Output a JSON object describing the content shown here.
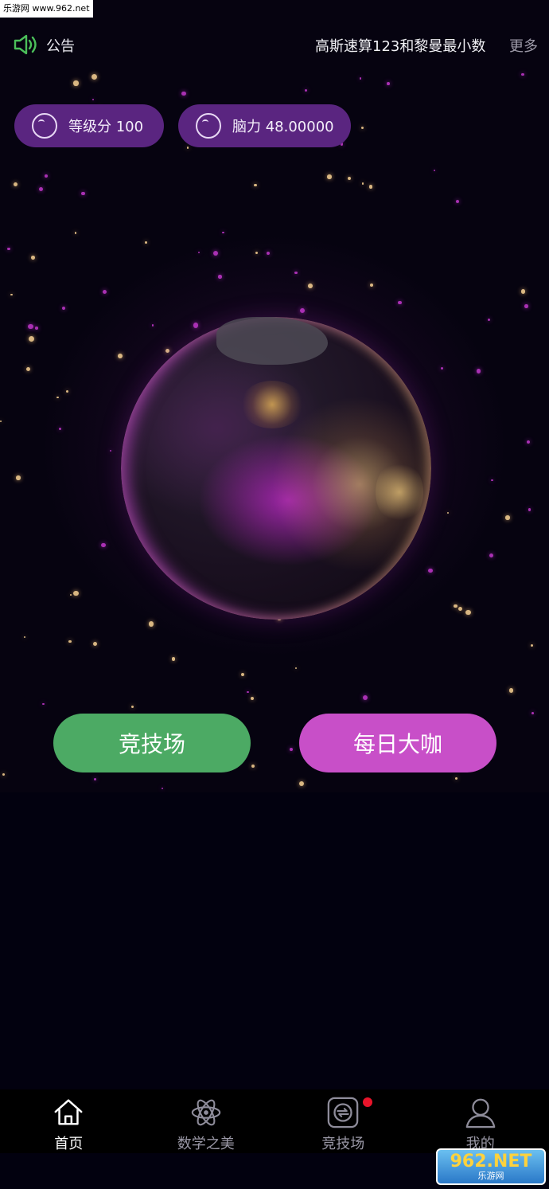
{
  "watermark": {
    "top_text": "乐游网 www.962.net",
    "brand": "962.NET",
    "brand_sub": "乐游网"
  },
  "notice": {
    "label": "公告",
    "marquee": "高斯速算123和黎曼最小数",
    "more": "更多"
  },
  "stats": {
    "level": "等级分 100",
    "brain": "脑力 48.00000"
  },
  "actions": {
    "arena": "竞技场",
    "daily": "每日大咖"
  },
  "tabs": [
    {
      "label": "首页",
      "icon": "home-icon",
      "active": true
    },
    {
      "label": "数学之美",
      "icon": "atom-icon",
      "active": false
    },
    {
      "label": "竞技场",
      "icon": "arena-icon",
      "active": false,
      "badge": true
    },
    {
      "label": "我的",
      "icon": "user-icon",
      "active": false
    }
  ],
  "colors": {
    "pill": "#5a2580",
    "arena_button": "#4caa64",
    "daily_button": "#c84fc8",
    "badge": "#e8142a"
  }
}
